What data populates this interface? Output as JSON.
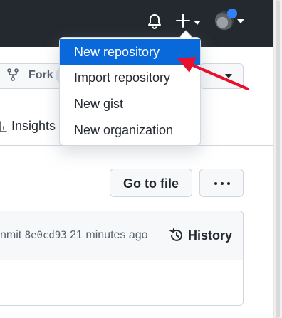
{
  "header": {
    "icons": [
      "bell-icon",
      "plus-icon",
      "chevron-down-icon",
      "avatar"
    ]
  },
  "repo_actions": {
    "fork_label": "Fork"
  },
  "tabs": {
    "insights_label": "Insights"
  },
  "file_actions": {
    "goto_label": "Go to file",
    "more_label": "···"
  },
  "commit": {
    "prefix": "nmit",
    "sha": "8e0cd93",
    "time": "21 minutes ago",
    "history_label": "History"
  },
  "create_menu": {
    "items": [
      {
        "label": "New repository",
        "active": true
      },
      {
        "label": "Import repository",
        "active": false
      },
      {
        "label": "New gist",
        "active": false
      },
      {
        "label": "New organization",
        "active": false
      }
    ]
  },
  "colors": {
    "header_bg": "#24292f",
    "accent": "#0969da",
    "annotation_arrow": "#e8112d"
  }
}
